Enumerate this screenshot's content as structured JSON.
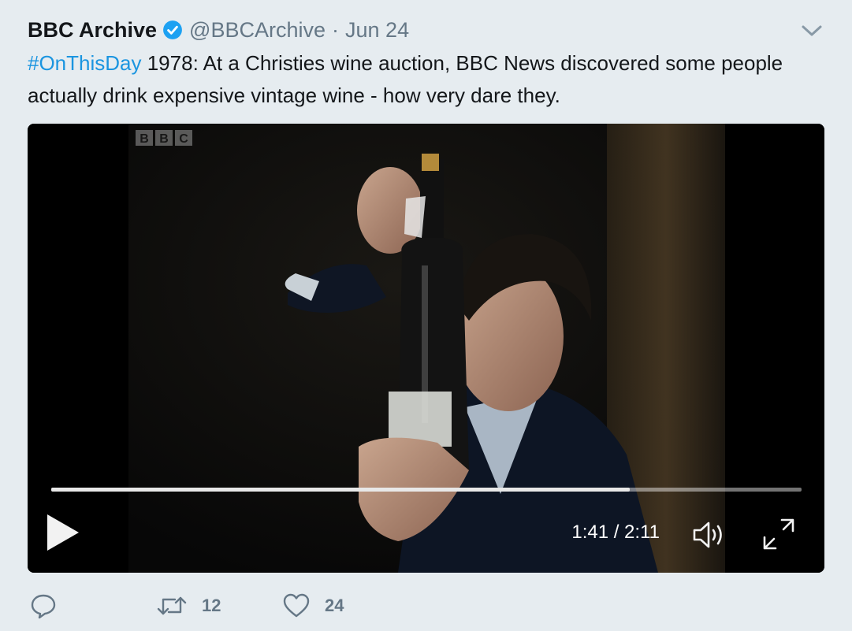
{
  "tweet": {
    "display_name": "BBC Archive",
    "handle": "@BBCArchive",
    "separator": "·",
    "date": "Jun 24",
    "verified": true,
    "hashtag": "#OnThisDay",
    "text": " 1978: At a Christies wine auction, BBC News discovered some people actually drink expensive vintage wine - how very dare they.",
    "hashtag_color": "#1b95e0"
  },
  "video": {
    "watermark": "BBC",
    "current_time": "1:41",
    "duration": "2:11",
    "time_display": "1:41 / 2:11",
    "progress_fraction": 0.771
  },
  "actions": {
    "reply_icon": "reply-icon",
    "retweet_icon": "retweet-icon",
    "like_icon": "heart-icon",
    "retweet_count": "12",
    "like_count": "24"
  },
  "colors": {
    "background": "#e6ecf0",
    "link": "#1b95e0",
    "secondary_text": "#657786"
  }
}
